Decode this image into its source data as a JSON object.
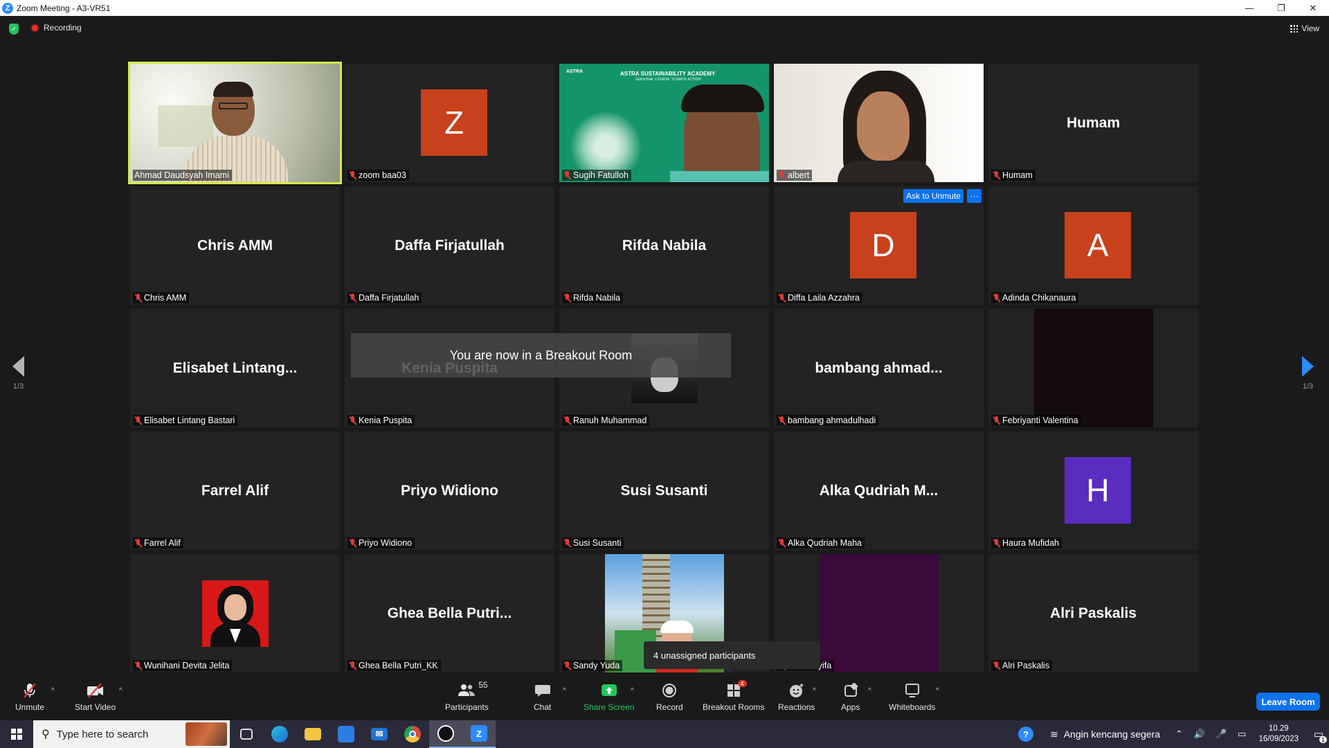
{
  "window": {
    "title": "Zoom Meeting - A3-VR51",
    "controls": [
      "—",
      "❐",
      "✕"
    ]
  },
  "topbar": {
    "recording_label": "Recording",
    "view_label": "View"
  },
  "tiles": [
    {
      "name": "Ahmad Daudsyah Imami",
      "kind": "video",
      "active": true,
      "muted": false
    },
    {
      "name": "zoom baa03",
      "kind": "avatar",
      "initial": "Z",
      "avatar_color": "#c8401c",
      "muted": true
    },
    {
      "name": "Sugih Fatulloh",
      "kind": "video",
      "muted": true
    },
    {
      "name": "albert",
      "kind": "video",
      "muted": true
    },
    {
      "name": "Humam",
      "kind": "name",
      "display": "Humam",
      "muted": true
    },
    {
      "name": "Chris AMM",
      "kind": "name",
      "display": "Chris AMM",
      "muted": true
    },
    {
      "name": "Daffa Firjatullah",
      "kind": "name",
      "display": "Daffa Firjatullah",
      "muted": true
    },
    {
      "name": "Rifda Nabila",
      "kind": "name",
      "display": "Rifda Nabila",
      "muted": true
    },
    {
      "name": "Diffa Laila Azzahra",
      "kind": "avatar",
      "initial": "D",
      "avatar_color": "#c8401c",
      "muted": true
    },
    {
      "name": "Adinda Chikanaura",
      "kind": "avatar",
      "initial": "A",
      "avatar_color": "#c8401c",
      "muted": true
    },
    {
      "name": "Elisabet Lintang Bastari",
      "kind": "name",
      "display": "Elisabet  Lintang...",
      "muted": true
    },
    {
      "name": "Kenia Puspita",
      "kind": "name",
      "display": "Kenia Puspita",
      "muted": true
    },
    {
      "name": "Ranuh Muhammad",
      "kind": "photo",
      "muted": true
    },
    {
      "name": "bambang ahmadulhadi",
      "kind": "name",
      "display": "bambang  ahmad...",
      "muted": true
    },
    {
      "name": "Febriyanti Valentina",
      "kind": "photo",
      "muted": true
    },
    {
      "name": "Farrel Alif",
      "kind": "name",
      "display": "Farrel Alif",
      "muted": true
    },
    {
      "name": "Priyo Widiono",
      "kind": "name",
      "display": "Priyo Widiono",
      "muted": true
    },
    {
      "name": "Susi Susanti",
      "kind": "name",
      "display": "Susi Susanti",
      "muted": true
    },
    {
      "name": "Alka Qudriah Maha",
      "kind": "name",
      "display": "Alka Qudriah M...",
      "muted": true
    },
    {
      "name": "Haura Mufidah",
      "kind": "avatar",
      "initial": "H",
      "avatar_color": "#5a2cc0",
      "muted": true
    },
    {
      "name": "Wunihani Devita Jelita",
      "kind": "photo",
      "muted": true
    },
    {
      "name": "Ghea Bella Putri_KK",
      "kind": "name",
      "display": "Ghea Bella Putri...",
      "muted": true
    },
    {
      "name": "Sandy Yuda",
      "kind": "photo",
      "muted": true
    },
    {
      "name": "Ainun Syifa",
      "kind": "photo",
      "muted": true
    },
    {
      "name": "Alri Paskalis",
      "kind": "name",
      "display": "Alri Paskalis",
      "muted": true
    }
  ],
  "overlays": {
    "breakout_message": "You are now in a Breakout Room",
    "unassigned_tooltip": "4 unassigned participants",
    "ask_to_unmute": "Ask to Unmute",
    "more": "···"
  },
  "pager": {
    "left": "1/3",
    "right": "1/3"
  },
  "toolbar": {
    "unmute": "Unmute",
    "start_video": "Start Video",
    "participants": "Participants",
    "participants_count": "55",
    "chat": "Chat",
    "share_screen": "Share Screen",
    "record": "Record",
    "breakout_rooms": "Breakout Rooms",
    "breakout_badge": "4",
    "reactions": "Reactions",
    "apps": "Apps",
    "whiteboards": "Whiteboards",
    "leave_room": "Leave Room"
  },
  "taskbar": {
    "search_placeholder": "Type here to search",
    "weather": "Angin kencang segera",
    "time": "10.29",
    "date": "16/09/2023",
    "notification_count": "1"
  },
  "slide_text": {
    "brand": "ASTRA",
    "title": "ASTRA SUSTAINABILITY ACADEMY",
    "subtitle": "SEASONAL COURSE \"CLIMATE ACTION\""
  },
  "colors": {
    "accent_blue": "#0e72ed",
    "active_speaker": "#d6e84a",
    "muted_red": "#e03a3a"
  }
}
